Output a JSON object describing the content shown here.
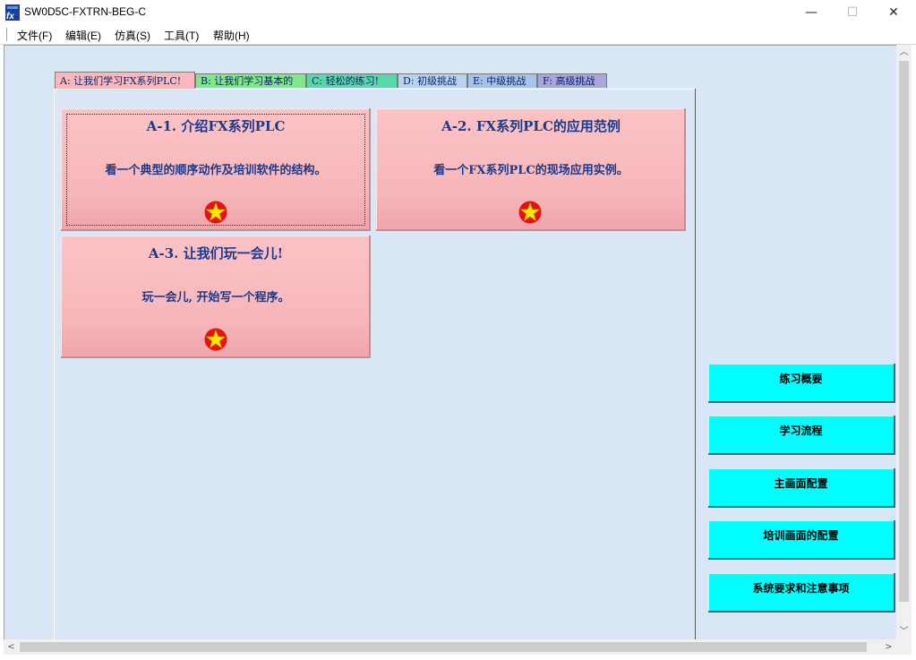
{
  "window": {
    "title": "SW0D5C-FXTRN-BEG-C",
    "app_icon": "fx-logo-icon",
    "controls": {
      "minimize": "—",
      "maximize": "☐",
      "close": "✕"
    }
  },
  "menu": [
    "文件(F)",
    "编辑(E)",
    "仿真(S)",
    "工具(T)",
    "帮助(H)"
  ],
  "tabs": [
    {
      "label": "A: 让我们学习FX系列PLC!",
      "color": "#f8b9bd",
      "active": true
    },
    {
      "label": "B: 让我们学习基本的",
      "color": "#7fe88a",
      "active": false
    },
    {
      "label": "C: 轻松的练习!",
      "color": "#58d8a8",
      "active": false
    },
    {
      "label": "D: 初级挑战",
      "color": "#b6d4f0",
      "active": false
    },
    {
      "label": "E: 中级挑战",
      "color": "#a6c4e8",
      "active": false
    },
    {
      "label": "F: 高级挑战",
      "color": "#a8a6dc",
      "active": false
    }
  ],
  "cards": [
    {
      "title": "A-1. 介绍FX系列PLC",
      "desc": "看一个典型的顺序动作及培训软件的结构。",
      "icon": "star-icon"
    },
    {
      "title": "A-2. FX系列PLC的应用范例",
      "desc": "看一个FX系列PLC的现场应用实例。",
      "icon": "star-icon"
    },
    {
      "title": "A-3. 让我们玩一会儿!",
      "desc": "玩一会儿, 开始写一个程序。",
      "icon": "star-icon"
    }
  ],
  "side_buttons": [
    "练习概要",
    "学习流程",
    "主画面配置",
    "培训画面的配置",
    "系统要求和注意事项"
  ],
  "colors": {
    "client_bg": "#d9e6f6",
    "card": "#f8b9bd",
    "card_text": "#1c3a8c",
    "side_button": "#00ffff"
  }
}
